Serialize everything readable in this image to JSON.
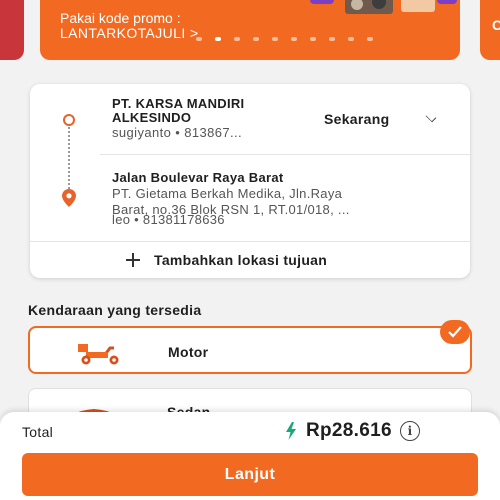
{
  "banner": {
    "promo_line1": "Pakai kode promo :",
    "promo_line2": "LANTARKOTAJULI >",
    "right_peek_text": "C",
    "dots_total": 10,
    "active_dot": 1,
    "colors": {
      "banner": "#f26a22",
      "left_peek": "#c8353b"
    }
  },
  "route": {
    "origin": {
      "name": "PT. KARSA MANDIRI ALKESINDO",
      "detail": "sugiyanto • 813867..."
    },
    "time_option": "Sekarang",
    "destination": {
      "name": "Jalan Boulevar Raya Barat",
      "address_lines": [
        "PT. Gietama Berkah Medika, Jln.Raya",
        "Barat, no.36 Blok RSN 1, RT.01/018, ...",
        "leo • 81381178636"
      ]
    },
    "add_destination": "Tambahkan lokasi tujuan"
  },
  "vehicles": {
    "title": "Kendaraan yang tersedia",
    "items": [
      {
        "name": "Motor",
        "icon": "scooter-icon",
        "selected": true
      },
      {
        "name": "Sedan",
        "icon": "car-icon",
        "selected": false
      }
    ]
  },
  "checkout": {
    "total_label": "Total",
    "price": "Rp28.616",
    "info_glyph": "i",
    "cta_label": "Lanjut",
    "accent": "#f26a22",
    "icons": {
      "price": "lightning-icon",
      "info": "info-icon"
    }
  }
}
